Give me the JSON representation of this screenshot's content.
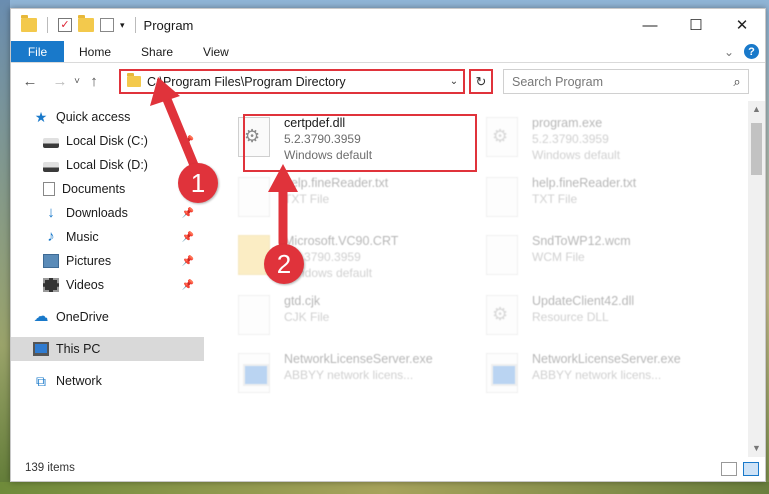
{
  "window": {
    "title": "Program",
    "controls": {
      "minimize": "—",
      "maximize": "☐",
      "close": "✕"
    }
  },
  "ribbon": {
    "tabs": [
      "File",
      "Home",
      "Share",
      "View"
    ],
    "expand_glyph": "⌄",
    "help_glyph": "?"
  },
  "address_bar": {
    "back_glyph": "←",
    "forward_glyph": "→",
    "recent_glyph": "˅",
    "up_glyph": "↑",
    "path": "C:\\Program Files\\Program Directory",
    "dropdown_glyph": "⌄",
    "refresh_glyph": "↻"
  },
  "search": {
    "placeholder": "Search Program",
    "icon": "search-icon",
    "icon_glyph": "⌕"
  },
  "navigation": {
    "pin_glyph": "📌",
    "items": [
      {
        "label": "Quick access",
        "icon": "star-icon",
        "icon_glyph": "★",
        "pinned": false
      },
      {
        "label": "Local Disk (C:)",
        "icon": "disk-icon",
        "pinned": true
      },
      {
        "label": "Local Disk (D:)",
        "icon": "disk-icon",
        "pinned": false
      },
      {
        "label": "Documents",
        "icon": "documents-icon",
        "pinned": true
      },
      {
        "label": "Downloads",
        "icon": "download-icon",
        "icon_glyph": "↓",
        "pinned": true
      },
      {
        "label": "Music",
        "icon": "music-icon",
        "icon_glyph": "♪",
        "pinned": true
      },
      {
        "label": "Pictures",
        "icon": "pictures-icon",
        "pinned": true
      },
      {
        "label": "Videos",
        "icon": "videos-icon",
        "pinned": true
      },
      {
        "label": "OneDrive",
        "icon": "cloud-icon",
        "icon_glyph": "☁",
        "pinned": false
      },
      {
        "label": "This PC",
        "icon": "computer-icon",
        "pinned": false,
        "selected": true
      },
      {
        "label": "Network",
        "icon": "network-icon",
        "icon_glyph": "⧉",
        "pinned": false
      }
    ]
  },
  "files": [
    {
      "name": "certpdef.dll",
      "version": "5.2.3790.3959",
      "type": "Windows default",
      "icon": "dll-gear-icon",
      "highlighted": true
    },
    {
      "name": "program.exe",
      "version": "5.2.3790.3959",
      "type": "Windows default",
      "icon": "exe-icon"
    },
    {
      "name": "help.fineReader.txt",
      "type": "TXT File",
      "icon": "txt-icon"
    },
    {
      "name": "help.fineReader.txt",
      "type": "TXT File",
      "icon": "txt-icon"
    },
    {
      "name": "Microsoft.VC90.CRT",
      "version": "5.2.3790.3959",
      "type": "Windows default",
      "icon": "folder-icon"
    },
    {
      "name": "SndToWP12.wcm",
      "type": "WCM File",
      "icon": "file-icon"
    },
    {
      "name": "gtd.cjk",
      "type": "CJK File",
      "icon": "file-icon"
    },
    {
      "name": "UpdateClient42.dll",
      "type": "Resource DLL",
      "icon": "dll-gear-icon"
    },
    {
      "name": "NetworkLicenseServer.exe",
      "type": "ABBYY network licens...",
      "icon": "exe-window-icon"
    },
    {
      "name": "NetworkLicenseServer.exe",
      "type": "ABBYY network licens...",
      "icon": "exe-window-icon"
    }
  ],
  "status": {
    "item_count": "139 items"
  },
  "scrollbar": {
    "up_glyph": "▲",
    "down_glyph": "▼"
  },
  "annotations": {
    "step1": "1",
    "step2": "2",
    "color": "#e0333b"
  }
}
